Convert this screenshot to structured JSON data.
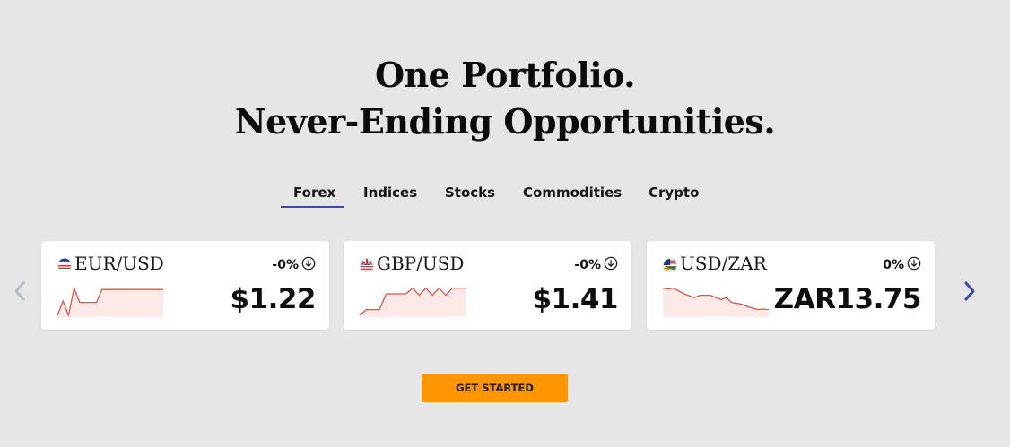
{
  "headline": {
    "line1": "One Portfolio.",
    "line2": "Never-Ending Opportunities."
  },
  "tabs": [
    {
      "label": "Forex",
      "active": true
    },
    {
      "label": "Indices",
      "active": false
    },
    {
      "label": "Stocks",
      "active": false
    },
    {
      "label": "Commodities",
      "active": false
    },
    {
      "label": "Crypto",
      "active": false
    }
  ],
  "carousel": {
    "prev_icon": "chevron-left-icon",
    "next_icon": "chevron-right-icon"
  },
  "cards": [
    {
      "pair": "EUR/USD",
      "flag_icon": "eu-us-flag-icon",
      "change": "-0%",
      "change_icon": "arrow-down-circle-icon",
      "price": "$1.22",
      "sparkline": [
        0.0,
        0.5,
        0.0,
        0.95,
        0.45,
        0.45,
        0.45,
        0.45,
        0.9,
        0.9,
        0.9,
        0.9,
        0.9,
        0.9,
        0.9,
        0.9,
        0.9,
        0.9,
        0.9,
        0.9
      ]
    },
    {
      "pair": "GBP/USD",
      "flag_icon": "gb-us-flag-icon",
      "change": "-0%",
      "change_icon": "arrow-down-circle-icon",
      "price": "$1.41",
      "sparkline": [
        0.0,
        0.2,
        0.2,
        0.2,
        0.75,
        0.75,
        0.75,
        0.75,
        0.95,
        0.7,
        0.95,
        0.7,
        0.95,
        0.7,
        0.95,
        0.95,
        0.95
      ]
    },
    {
      "pair": "USD/ZAR",
      "flag_icon": "us-za-flag-icon",
      "change": "0%",
      "change_icon": "arrow-down-circle-icon",
      "price": "ZAR13.75",
      "sparkline": [
        0.95,
        0.92,
        0.95,
        0.85,
        0.75,
        0.68,
        0.62,
        0.7,
        0.7,
        0.7,
        0.62,
        0.55,
        0.62,
        0.45,
        0.42,
        0.38,
        0.3,
        0.25,
        0.2,
        0.22,
        0.2
      ]
    }
  ],
  "cta": {
    "label": "GET STARTED"
  },
  "colors": {
    "background": "#e6e6e7",
    "accent_underline": "#3a4aa6",
    "cta": "#ff9600",
    "spark_line": "#e2524a",
    "spark_fill": "#fde9e7",
    "nav_arrow_active": "#3a4aa6",
    "nav_arrow_inactive": "#b9bccb"
  }
}
